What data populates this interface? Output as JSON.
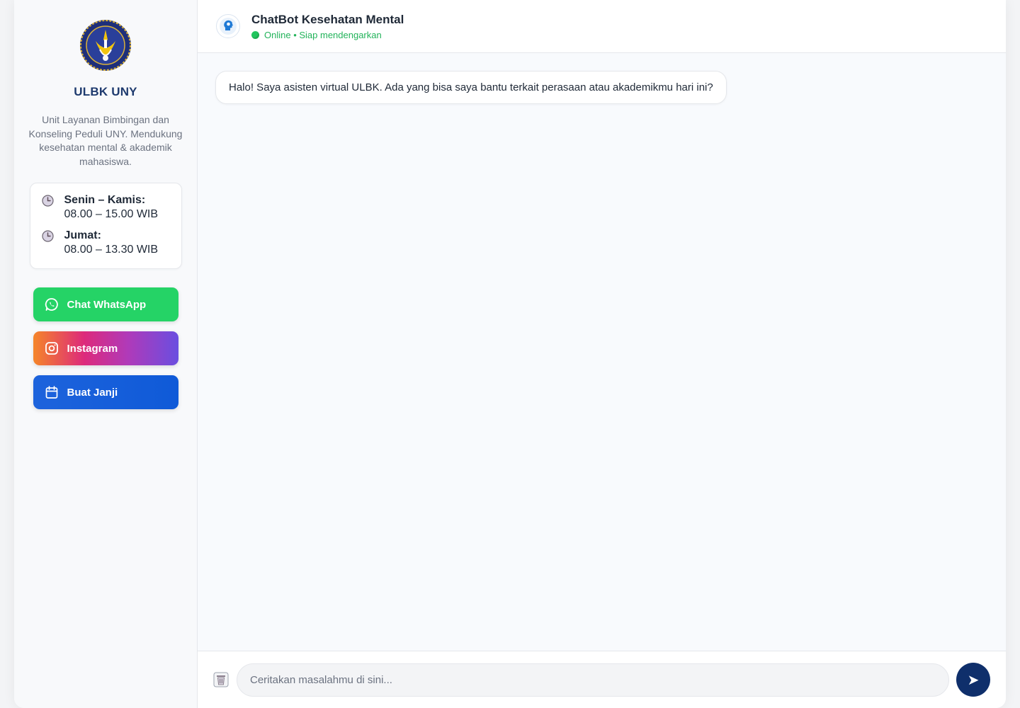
{
  "sidebar": {
    "title": "ULBK UNY",
    "description": "Unit Layanan Bimbingan dan Konseling Peduli UNY. Mendukung kesehatan mental & akademik mahasiswa.",
    "hours": [
      {
        "day": "Senin – Kamis:",
        "time": "08.00 – 15.00 WIB"
      },
      {
        "day": "Jumat:",
        "time": "08.00 – 13.30 WIB"
      }
    ],
    "buttons": {
      "whatsapp": "Chat WhatsApp",
      "instagram": "Instagram",
      "appointment": "Buat Janji"
    }
  },
  "header": {
    "title": "ChatBot Kesehatan Mental",
    "status": "Online • Siap mendengarkan"
  },
  "messages": [
    {
      "from": "bot",
      "text": "Halo! Saya asisten virtual ULBK. Ada yang bisa saya bantu terkait perasaan atau akademikmu hari ini?"
    }
  ],
  "composer": {
    "placeholder": "Ceritakan masalahmu di sini...",
    "send_icon": "➤"
  },
  "colors": {
    "brand_navy": "#1e3a6e",
    "whatsapp": "#25d366",
    "appointment": "#1d63dc",
    "online": "#22c55e",
    "send": "#0f2f6b"
  }
}
